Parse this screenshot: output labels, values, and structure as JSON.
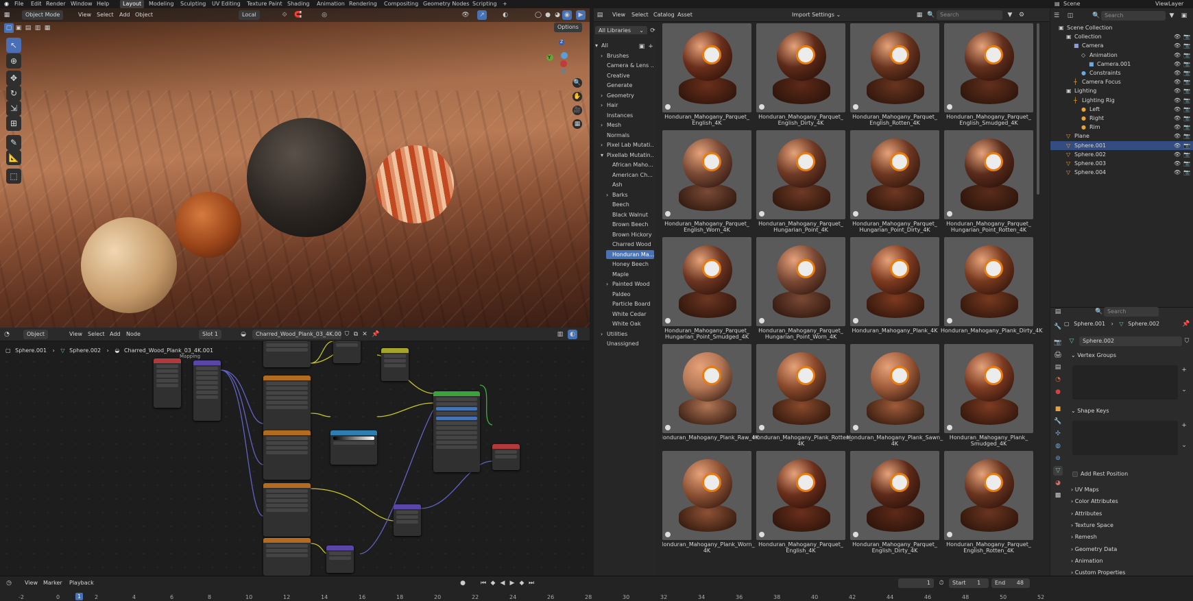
{
  "topbar": {
    "menus": [
      "File",
      "Edit",
      "Render",
      "Window",
      "Help"
    ],
    "workspaces": [
      "Layout",
      "Modeling",
      "Sculpting",
      "UV Editing",
      "Texture Paint",
      "Shading",
      "Animation",
      "Rendering",
      "Compositing",
      "Geometry Nodes",
      "Scripting"
    ],
    "active_workspace": "Layout",
    "add_tab": "+",
    "scene_label": "Scene",
    "viewlayer_label": "ViewLayer"
  },
  "viewport": {
    "mode": "Object Mode",
    "menus": [
      "View",
      "Select",
      "Add",
      "Object"
    ],
    "orientation": "Local",
    "options": "Options",
    "gizmo": {
      "z": "Z",
      "y": "Y",
      "x": "X"
    }
  },
  "node_editor": {
    "type": "Object",
    "menus": [
      "View",
      "Select",
      "Add",
      "Node"
    ],
    "slot": "Slot 1",
    "material": "Charred_Wood_Plank_03_4K.001",
    "breadcrumb": [
      "Sphere.001",
      "Sphere.002",
      "Charred_Wood_Plank_03_4K.001"
    ],
    "mapping_label": "Mapping"
  },
  "timeline": {
    "menus": [
      "View",
      "Marker",
      "Playback"
    ],
    "current_frame": "1",
    "start_label": "Start",
    "start": "1",
    "end_label": "End",
    "end": "48",
    "ticks": [
      "-2",
      "0",
      "1",
      "2",
      "4",
      "6",
      "8",
      "10",
      "12",
      "14",
      "16",
      "18",
      "20",
      "22",
      "24",
      "26",
      "28",
      "30",
      "32",
      "34",
      "36",
      "38",
      "40",
      "42",
      "44",
      "46",
      "48",
      "50",
      "52"
    ]
  },
  "file_browser": {
    "menus": [
      "View",
      "Select",
      "Catalog",
      "Asset"
    ],
    "import_settings": "Import Settings",
    "search_placeholder": "Search",
    "library": "All Libraries",
    "catalogs": [
      {
        "label": "All",
        "level": 0,
        "arrow": "▾"
      },
      {
        "label": "Brushes",
        "level": 1,
        "arrow": "›"
      },
      {
        "label": "Camera & Lens ...",
        "level": 1,
        "arrow": ""
      },
      {
        "label": "Creative",
        "level": 1,
        "arrow": ""
      },
      {
        "label": "Generate",
        "level": 1,
        "arrow": ""
      },
      {
        "label": "Geometry",
        "level": 1,
        "arrow": "›"
      },
      {
        "label": "Hair",
        "level": 1,
        "arrow": "›"
      },
      {
        "label": "Instances",
        "level": 1,
        "arrow": ""
      },
      {
        "label": "Mesh",
        "level": 1,
        "arrow": "›"
      },
      {
        "label": "Normals",
        "level": 1,
        "arrow": ""
      },
      {
        "label": "Pixel Lab Mutati...",
        "level": 1,
        "arrow": "›"
      },
      {
        "label": "Pixellab Mutatin...",
        "level": 1,
        "arrow": "▾"
      },
      {
        "label": "African Maho...",
        "level": 2,
        "arrow": ""
      },
      {
        "label": "American Ch...",
        "level": 2,
        "arrow": ""
      },
      {
        "label": "Ash",
        "level": 2,
        "arrow": ""
      },
      {
        "label": "Barks",
        "level": 2,
        "arrow": "›"
      },
      {
        "label": "Beech",
        "level": 2,
        "arrow": ""
      },
      {
        "label": "Black Walnut",
        "level": 2,
        "arrow": ""
      },
      {
        "label": "Brown Beech",
        "level": 2,
        "arrow": ""
      },
      {
        "label": "Brown Hickory",
        "level": 2,
        "arrow": ""
      },
      {
        "label": "Charred Wood",
        "level": 2,
        "arrow": ""
      },
      {
        "label": "Honduran Ma...",
        "level": 2,
        "arrow": "",
        "selected": true
      },
      {
        "label": "Honey Beech",
        "level": 2,
        "arrow": ""
      },
      {
        "label": "Maple",
        "level": 2,
        "arrow": ""
      },
      {
        "label": "Painted Wood",
        "level": 2,
        "arrow": "›"
      },
      {
        "label": "Paldeo",
        "level": 2,
        "arrow": ""
      },
      {
        "label": "Particle Board",
        "level": 2,
        "arrow": ""
      },
      {
        "label": "White Cedar",
        "level": 2,
        "arrow": ""
      },
      {
        "label": "White Oak",
        "level": 2,
        "arrow": ""
      },
      {
        "label": "Utilities",
        "level": 1,
        "arrow": "›"
      },
      {
        "label": "Unassigned",
        "level": 1,
        "arrow": ""
      }
    ],
    "assets": [
      {
        "l1": "Honduran_Mahogany_Parquet_",
        "l2": "English_4K",
        "c": "#6b2f1c"
      },
      {
        "l1": "Honduran_Mahogany_Parquet_",
        "l2": "English_Dirty_4K",
        "c": "#5d2a19"
      },
      {
        "l1": "Honduran_Mahogany_Parquet_",
        "l2": "English_Rotten_4K",
        "c": "#6a3520"
      },
      {
        "l1": "Honduran_Mahogany_Parquet_",
        "l2": "English_Smudged_4K",
        "c": "#62301d"
      },
      {
        "l1": "Honduran_Mahogany_Parquet_",
        "l2": "English_Worn_4K",
        "c": "#7a4a36"
      },
      {
        "l1": "Honduran_Mahogany_Parquet_",
        "l2": "Hungarian_Point_4K",
        "c": "#6f3a25"
      },
      {
        "l1": "Honduran_Mahogany_Parquet_",
        "l2": "Hungarian_Point_Dirty_4K",
        "c": "#6e3822"
      },
      {
        "l1": "Honduran_Mahogany_Parquet_",
        "l2": "Hungarian_Point_Rotten_4K",
        "c": "#5a2c1c"
      },
      {
        "l1": "Honduran_Mahogany_Parquet_",
        "l2": "Hungarian_Point_Smudged_4K",
        "c": "#6d3622"
      },
      {
        "l1": "Honduran_Mahogany_Parquet_",
        "l2": "Hungarian_Point_Worn_4K",
        "c": "#7b4935"
      },
      {
        "l1": "Honduran_Mahogany_Plank_4K",
        "l2": "",
        "c": "#7e3a20"
      },
      {
        "l1": "Honduran_Mahogany_Plank_Dirty_4K",
        "l2": "",
        "c": "#77391f"
      },
      {
        "l1": "Honduran_Mahogany_Plank_Raw_4K",
        "l2": "",
        "c": "#b37655"
      },
      {
        "l1": "Honduran_Mahogany_Plank_Rotten_",
        "l2": "4K",
        "c": "#8a4a2c"
      },
      {
        "l1": "Honduran_Mahogany_Plank_Sawn_",
        "l2": "4K",
        "c": "#a05c3a"
      },
      {
        "l1": "Honduran_Mahogany_Plank_",
        "l2": "Smudged_4K",
        "c": "#7d3b22"
      },
      {
        "l1": "Honduran_Mahogany_Plank_Worn_",
        "l2": "4K",
        "c": "#8e5235"
      },
      {
        "l1": "Honduran_Mahogany_Parquet_",
        "l2": "English_4K",
        "c": "#6b2f1c"
      },
      {
        "l1": "Honduran_Mahogany_Parquet_",
        "l2": "English_Dirty_4K",
        "c": "#5d2a19"
      },
      {
        "l1": "Honduran_Mahogany_Parquet_",
        "l2": "English_Rotten_4K",
        "c": "#6a3520"
      }
    ]
  },
  "outliner": {
    "search_placeholder": "Search",
    "rows": [
      {
        "label": "Scene Collection",
        "indent": 0,
        "icon": "▣",
        "ic": "#cfcfcf"
      },
      {
        "label": "Collection",
        "indent": 1,
        "icon": "▣",
        "ic": "#cfcfcf"
      },
      {
        "label": "Camera",
        "indent": 2,
        "icon": "■",
        "ic": "#8a9fd6"
      },
      {
        "label": "Animation",
        "indent": 3,
        "icon": "◇",
        "ic": "#cfcfcf"
      },
      {
        "label": "Camera.001",
        "indent": 4,
        "icon": "■",
        "ic": "#6fa8dc"
      },
      {
        "label": "Constraints",
        "indent": 3,
        "icon": "●",
        "ic": "#6fa8dc"
      },
      {
        "label": "Camera Focus",
        "indent": 2,
        "icon": "┼",
        "ic": "#e8a23c"
      },
      {
        "label": "Lighting",
        "indent": 1,
        "icon": "▣",
        "ic": "#cfcfcf"
      },
      {
        "label": "Lighting Rig",
        "indent": 2,
        "icon": "┼",
        "ic": "#e8a23c"
      },
      {
        "label": "Left",
        "indent": 3,
        "icon": "●",
        "ic": "#e8a23c"
      },
      {
        "label": "Right",
        "indent": 3,
        "icon": "●",
        "ic": "#e8a23c"
      },
      {
        "label": "Rim",
        "indent": 3,
        "icon": "●",
        "ic": "#e8a23c"
      },
      {
        "label": "Plane",
        "indent": 1,
        "icon": "▽",
        "ic": "#e8a23c"
      },
      {
        "label": "Sphere.001",
        "indent": 1,
        "icon": "▽",
        "ic": "#e8a23c",
        "selected": true
      },
      {
        "label": "Sphere.002",
        "indent": 1,
        "icon": "▽",
        "ic": "#e8a23c"
      },
      {
        "label": "Sphere.003",
        "indent": 1,
        "icon": "▽",
        "ic": "#e8a23c"
      },
      {
        "label": "Sphere.004",
        "indent": 1,
        "icon": "▽",
        "ic": "#e8a23c"
      }
    ]
  },
  "properties": {
    "search_placeholder": "Search",
    "breadcrumb_obj": "Sphere.001",
    "breadcrumb_data": "Sphere.002",
    "mesh_name": "Sphere.002",
    "vertex_groups": "Vertex Groups",
    "shape_keys": "Shape Keys",
    "add_rest_position": "Add Rest Position",
    "sections": [
      "UV Maps",
      "Color Attributes",
      "Attributes",
      "Texture Space",
      "Remesh",
      "Geometry Data",
      "Animation",
      "Custom Properties"
    ]
  }
}
